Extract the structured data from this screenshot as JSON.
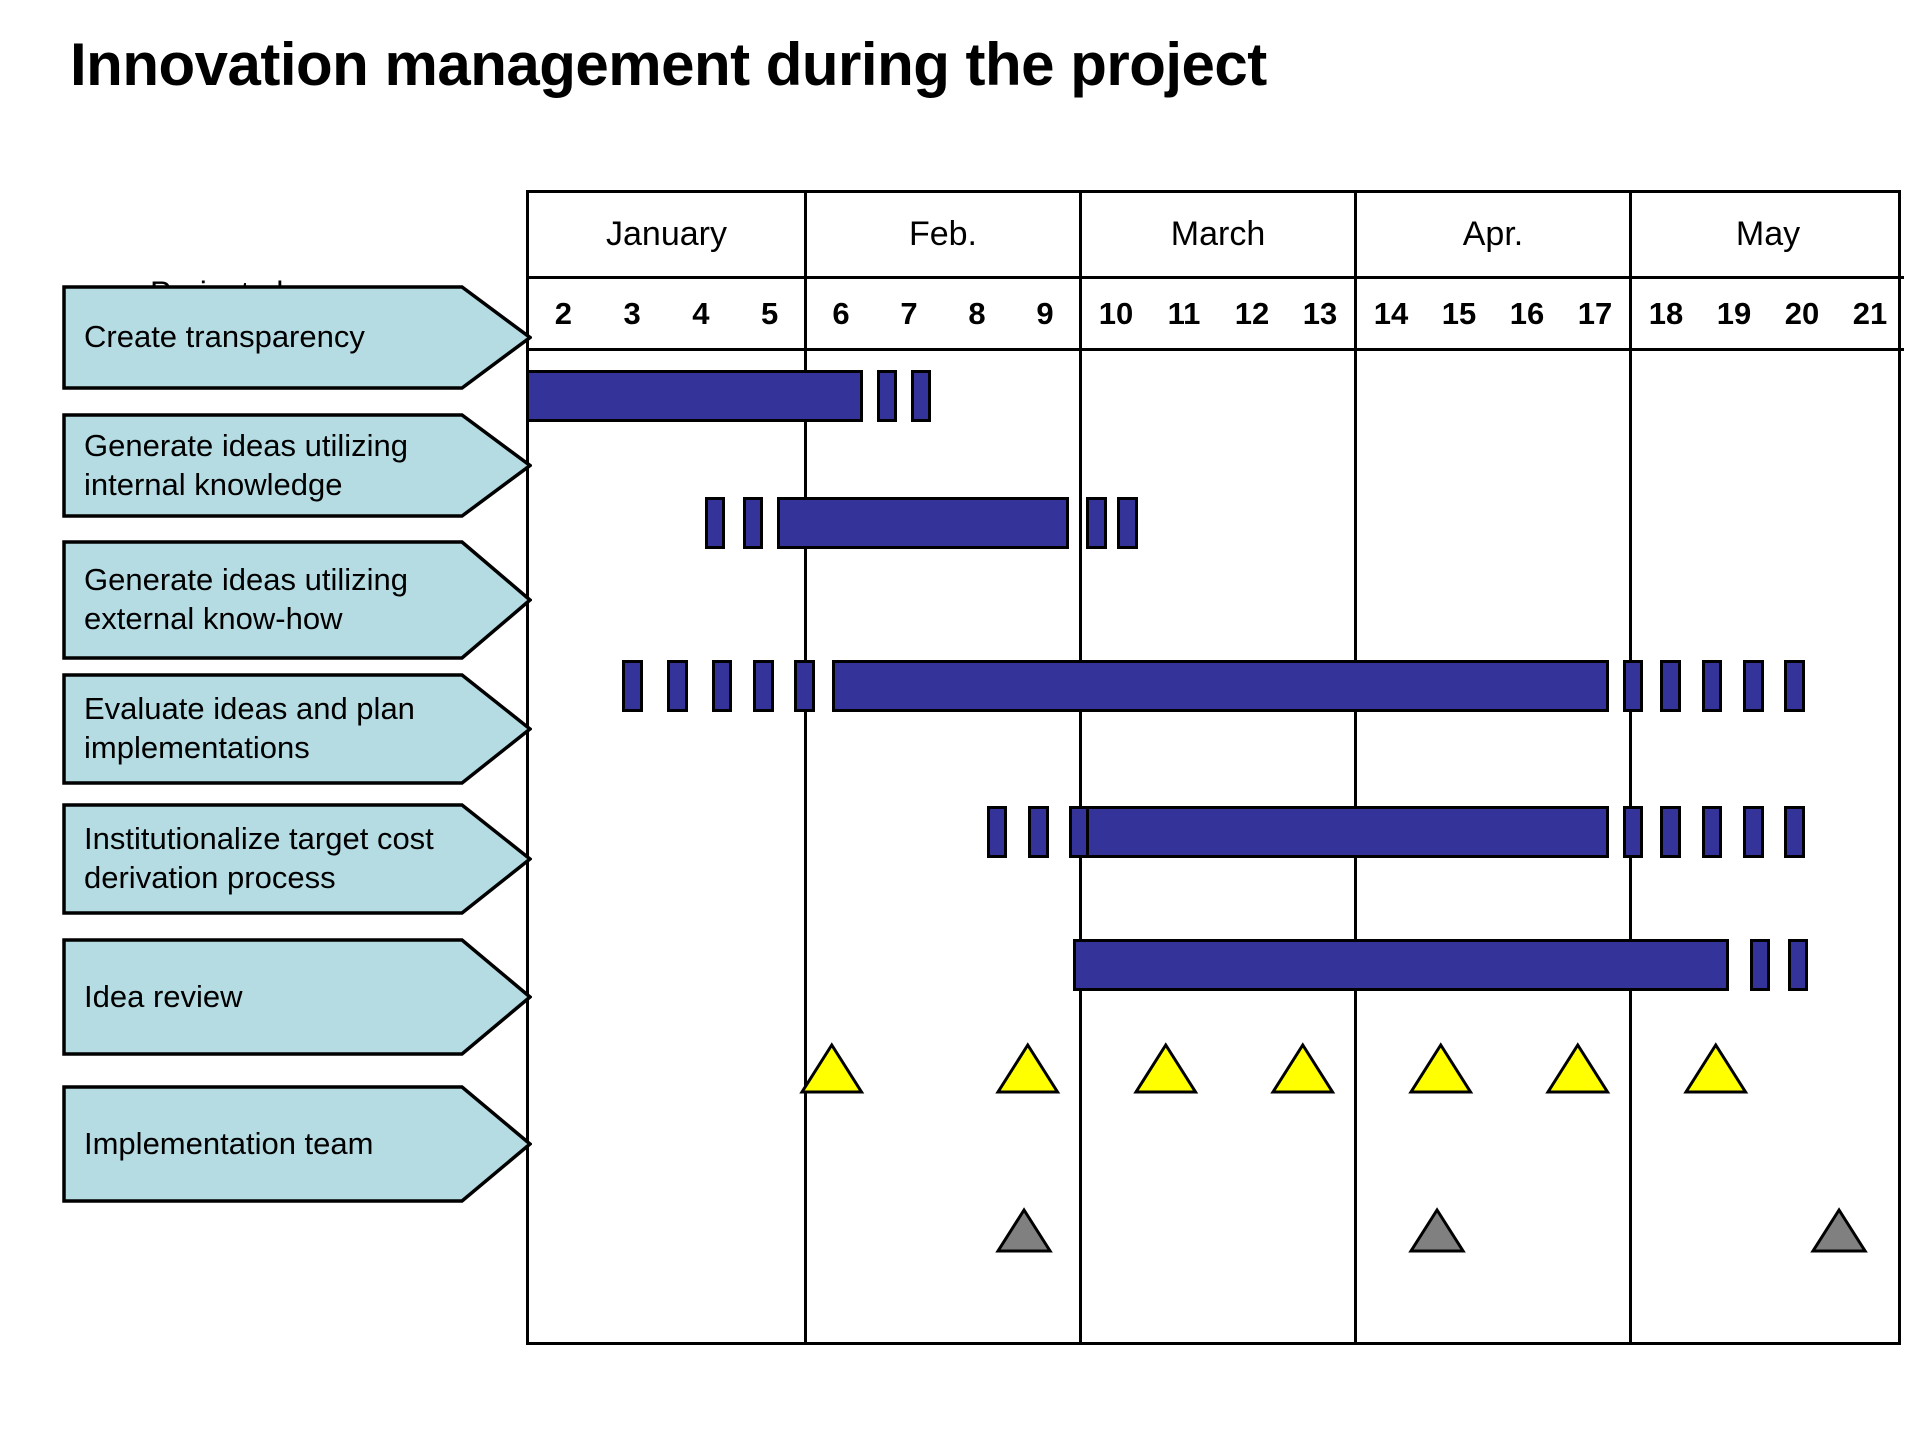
{
  "title": "Innovation management during the project",
  "row_header_label": "Project phase",
  "colors": {
    "bar": "#333399",
    "phase_arrow": "#b5dce3",
    "idea_review_marker": "#ffff00",
    "implementation_marker": "#808080",
    "outline": "#000000",
    "background": "#ffffff"
  },
  "chart_data": {
    "type": "bar",
    "title": "Innovation management during the project",
    "xlabel": "",
    "ylabel": "Project phase",
    "grid": true,
    "legend_position": "none",
    "months": [
      "January",
      "Feb.",
      "March",
      "Apr.",
      "May"
    ],
    "weeks": [
      [
        "2",
        "3",
        "4",
        "5"
      ],
      [
        "6",
        "7",
        "8",
        "9"
      ],
      [
        "10",
        "11",
        "12",
        "13"
      ],
      [
        "14",
        "15",
        "16",
        "17"
      ],
      [
        "18",
        "19",
        "20",
        "21"
      ]
    ],
    "week_range": [
      2,
      21
    ],
    "categories": [
      "Create transparency",
      "Generate ideas utilizing internal knowledge",
      "Generate ideas utilizing external know-how",
      "Evaluate ideas and plan implementations",
      "Institutionalize target cost derivation process",
      "Idea review",
      "Implementation team"
    ],
    "series": [
      {
        "name": "Create transparency",
        "type": "bar-row",
        "segments": [
          {
            "start_week": 2.0,
            "end_week": 6.9,
            "kind": "solid"
          },
          {
            "start_week": 7.1,
            "end_week": 7.35,
            "kind": "tick"
          },
          {
            "start_week": 7.6,
            "end_week": 7.85,
            "kind": "tick"
          }
        ]
      },
      {
        "name": "Generate ideas utilizing internal knowledge",
        "type": "bar-row",
        "segments": [
          {
            "start_week": 4.6,
            "end_week": 4.9,
            "kind": "tick"
          },
          {
            "start_week": 5.15,
            "end_week": 5.45,
            "kind": "tick"
          },
          {
            "start_week": 5.65,
            "end_week": 9.9,
            "kind": "solid"
          },
          {
            "start_week": 10.15,
            "end_week": 10.45,
            "kind": "tick"
          },
          {
            "start_week": 10.6,
            "end_week": 10.9,
            "kind": "tick"
          }
        ]
      },
      {
        "name": "Generate ideas utilizing external know-how",
        "type": "bar-row",
        "segments": [
          {
            "start_week": 3.4,
            "end_week": 3.7,
            "kind": "tick"
          },
          {
            "start_week": 4.05,
            "end_week": 4.35,
            "kind": "tick"
          },
          {
            "start_week": 4.7,
            "end_week": 5.0,
            "kind": "tick"
          },
          {
            "start_week": 5.3,
            "end_week": 5.6,
            "kind": "tick"
          },
          {
            "start_week": 5.9,
            "end_week": 6.2,
            "kind": "tick"
          },
          {
            "start_week": 6.45,
            "end_week": 17.75,
            "kind": "solid"
          },
          {
            "start_week": 17.95,
            "end_week": 18.25,
            "kind": "tick"
          },
          {
            "start_week": 18.5,
            "end_week": 18.8,
            "kind": "tick"
          },
          {
            "start_week": 19.1,
            "end_week": 19.4,
            "kind": "tick"
          },
          {
            "start_week": 19.7,
            "end_week": 20.0,
            "kind": "tick"
          },
          {
            "start_week": 20.3,
            "end_week": 20.6,
            "kind": "tick"
          }
        ]
      },
      {
        "name": "Evaluate ideas and plan implementations",
        "type": "bar-row",
        "segments": [
          {
            "start_week": 8.7,
            "end_week": 9.0,
            "kind": "tick"
          },
          {
            "start_week": 9.3,
            "end_week": 9.6,
            "kind": "tick"
          },
          {
            "start_week": 9.9,
            "end_week": 10.2,
            "kind": "tick"
          },
          {
            "start_week": 10.15,
            "end_week": 17.75,
            "kind": "solid"
          },
          {
            "start_week": 17.95,
            "end_week": 18.25,
            "kind": "tick"
          },
          {
            "start_week": 18.5,
            "end_week": 18.8,
            "kind": "tick"
          },
          {
            "start_week": 19.1,
            "end_week": 19.4,
            "kind": "tick"
          },
          {
            "start_week": 19.7,
            "end_week": 20.0,
            "kind": "tick"
          },
          {
            "start_week": 20.3,
            "end_week": 20.6,
            "kind": "tick"
          }
        ]
      },
      {
        "name": "Institutionalize target cost derivation process",
        "type": "bar-row",
        "segments": [
          {
            "start_week": 9.95,
            "end_week": 19.5,
            "kind": "solid"
          },
          {
            "start_week": 19.8,
            "end_week": 20.1,
            "kind": "tick"
          },
          {
            "start_week": 20.35,
            "end_week": 20.65,
            "kind": "tick"
          }
        ]
      },
      {
        "name": "Idea review",
        "type": "milestone-row",
        "marker": "triangle",
        "marker_color": "#ffff00",
        "milestones_week": [
          6.45,
          9.3,
          11.3,
          13.3,
          15.3,
          17.3,
          19.3
        ]
      },
      {
        "name": "Implementation team",
        "type": "milestone-row",
        "marker": "triangle",
        "marker_color": "#808080",
        "milestones_week": [
          9.25,
          15.25,
          21.1
        ]
      }
    ]
  },
  "phases": [
    {
      "label": "Create transparency"
    },
    {
      "label": "Generate ideas utilizing\ninternal knowledge"
    },
    {
      "label": "Generate ideas utilizing\nexternal know-how"
    },
    {
      "label": "Evaluate ideas and plan\nimplementations"
    },
    {
      "label": "Institutionalize target cost\nderivation process"
    },
    {
      "label": " Idea review"
    },
    {
      "label": "Implementation  team"
    }
  ]
}
